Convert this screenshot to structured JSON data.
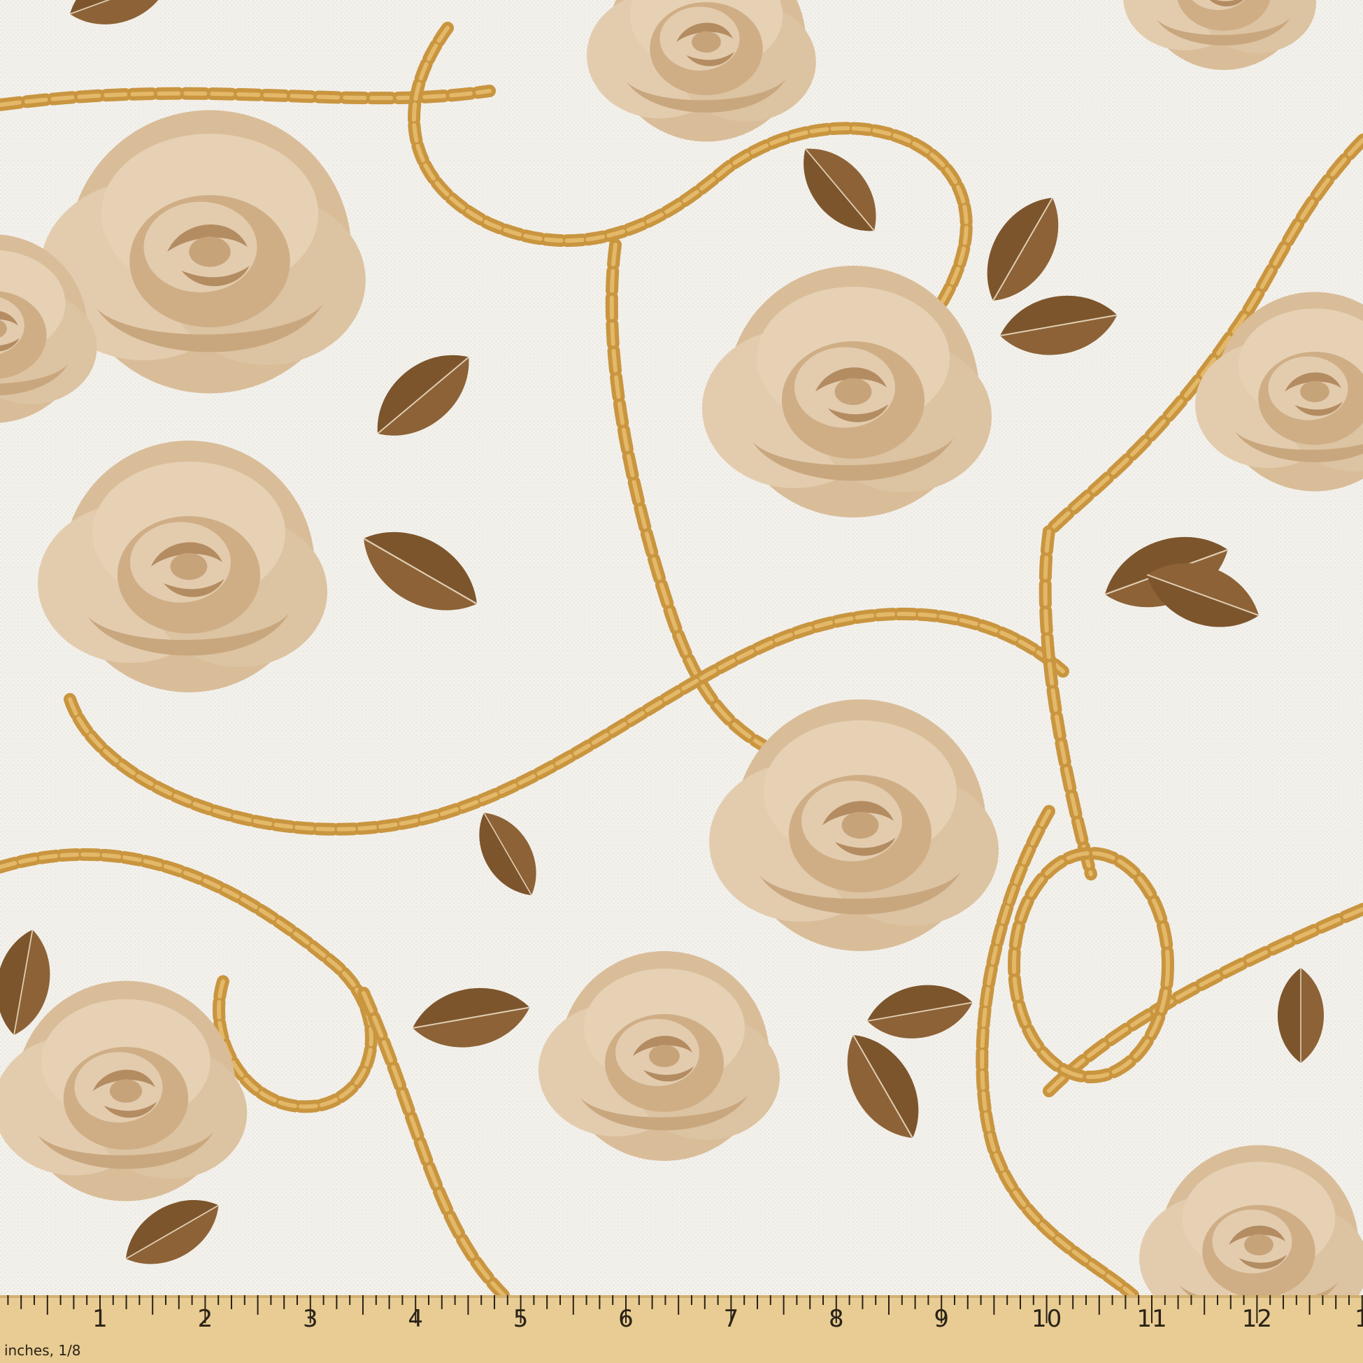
{
  "colors": {
    "background": "#f3f1ec",
    "rose_light": "#e3ccae",
    "rose_mid": "#cfae86",
    "rose_dark": "#b48c62",
    "leaf": "#8c6236",
    "leaf_dark": "#6f4a24",
    "chain": "#c9953f",
    "chain_light": "#e3b868",
    "ruler_wood": "#e8cc93",
    "ruler_ink": "#2a2216"
  },
  "ruler": {
    "unit_label": "inches, 1/8",
    "numbers": [
      "1",
      "2",
      "3",
      "4",
      "5",
      "6",
      "7",
      "8",
      "9",
      "10",
      "11",
      "12",
      "1"
    ]
  }
}
